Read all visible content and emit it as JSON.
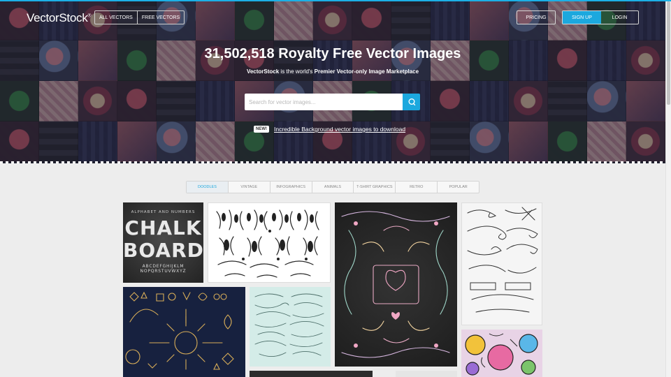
{
  "header": {
    "logo_text": "VectorStock",
    "logo_mark": "®",
    "nav": {
      "all_vectors": "ALL VECTORS",
      "free_vectors": "FREE VECTORS"
    },
    "pricing": "PRICING",
    "sign_up": "SIGN UP",
    "login": "LOGIN"
  },
  "hero": {
    "headline": "31,502,518 Royalty Free Vector Images",
    "sub_brand": "VectorStock",
    "sub_middle": " is the world's ",
    "sub_bold": "Premier Vector-only Image Marketplace",
    "search_placeholder": "Search for vector images...",
    "new_badge": "NEW!",
    "promo_link": "Incredible Background vector images to download"
  },
  "tabs": [
    {
      "label": "DOODLES",
      "active": true
    },
    {
      "label": "VINTAGE",
      "active": false
    },
    {
      "label": "INFOGRAPHICS",
      "active": false
    },
    {
      "label": "ANIMALS",
      "active": false
    },
    {
      "label": "T-SHIRT GRAPHICS",
      "active": false
    },
    {
      "label": "RETRO",
      "active": false
    },
    {
      "label": "POPULAR",
      "active": false
    }
  ],
  "gallery": {
    "chalkboard": {
      "top_text": "ALPHABET AND NUMBERS",
      "word1": "CHALK",
      "word2": "BOARD",
      "alphabet": "ABCDEFGHIJKLM NOPQRSTUVWXYZ"
    }
  },
  "colors": {
    "accent": "#1ca8de",
    "hero_dark": "#2b2d3d",
    "page_bg": "#ededed"
  }
}
